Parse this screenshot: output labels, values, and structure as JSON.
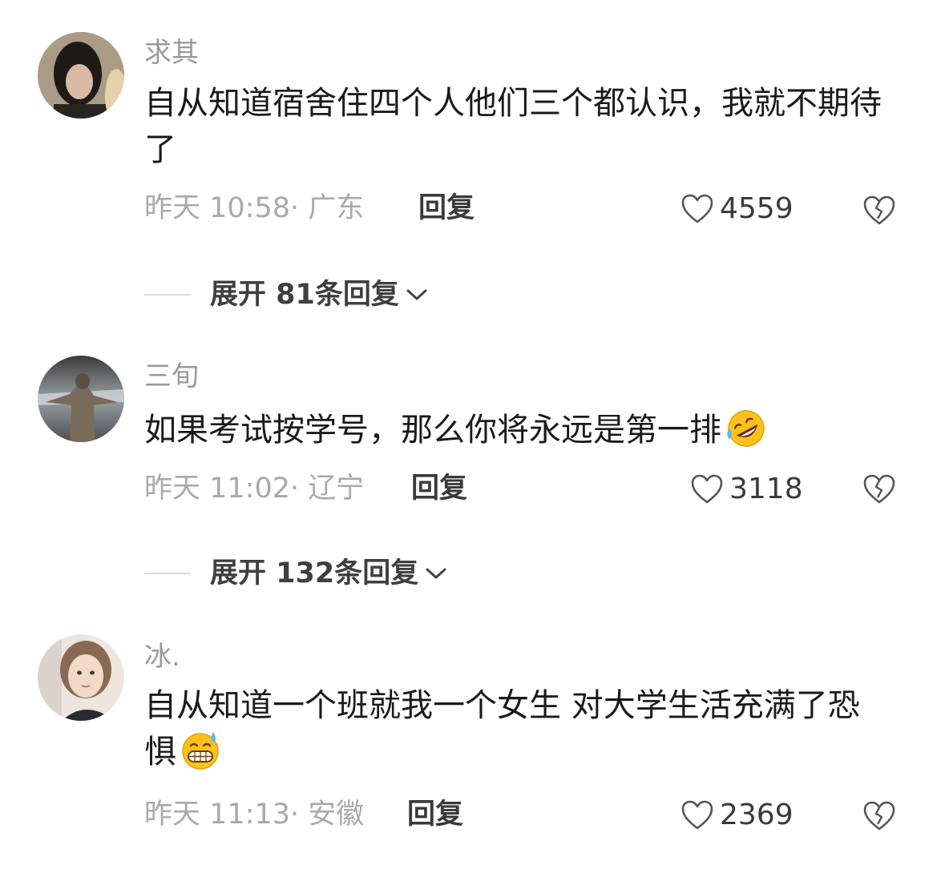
{
  "comments": [
    {
      "username": "求其",
      "text": "自从知道宿舍住四个人他们三个都认识，我就不期待了",
      "time": "昨天 10:58",
      "location": "广东",
      "reply_label": "回复",
      "likes": "4559",
      "expand_label": "展开 81条回复"
    },
    {
      "username": "三旬",
      "text": "如果考试按学号，那么你将永远是第一排",
      "emoji": "rolling-on-floor-laughing",
      "time": "昨天 11:02",
      "location": "辽宁",
      "reply_label": "回复",
      "likes": "3118",
      "expand_label": "展开 132条回复"
    },
    {
      "username": "冰.",
      "text": "自从知道一个班就我一个女生 对大学生活充满了恐惧",
      "emoji": "grinning-sweat",
      "time": "昨天 11:13",
      "location": "安徽",
      "reply_label": "回复",
      "likes": "2369"
    }
  ],
  "meta_separator": "·",
  "icons": {
    "like": "heart-outline-icon",
    "dislike": "broken-heart-icon",
    "expand": "chevron-down-icon"
  }
}
